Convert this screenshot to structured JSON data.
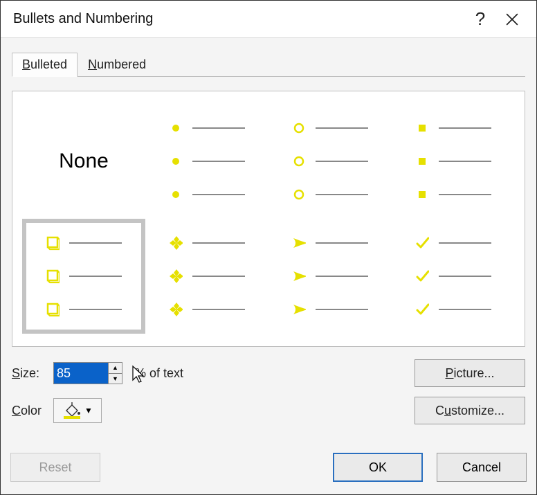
{
  "title": "Bullets and Numbering",
  "tabs": {
    "bulleted": "ulleted",
    "bulleted_acc": "B",
    "numbered": "umbered",
    "numbered_acc": "N"
  },
  "none_label": "None",
  "bullet_styles": [
    {
      "type": "none"
    },
    {
      "type": "disc"
    },
    {
      "type": "circle"
    },
    {
      "type": "square"
    },
    {
      "type": "box3d",
      "selected": true
    },
    {
      "type": "diamond4"
    },
    {
      "type": "arrow"
    },
    {
      "type": "check"
    }
  ],
  "size": {
    "label_acc": "S",
    "label_rest": "ize:",
    "value": "85",
    "suffix": "% of text"
  },
  "color": {
    "label_acc": "C",
    "label_rest": "olor",
    "value": "#e6e000"
  },
  "buttons": {
    "picture": "icture...",
    "picture_acc": "P",
    "customize": "ustomize...",
    "customize_acc": "C",
    "reset": "eset",
    "reset_acc": "R",
    "ok": "OK",
    "cancel": "Cancel"
  }
}
